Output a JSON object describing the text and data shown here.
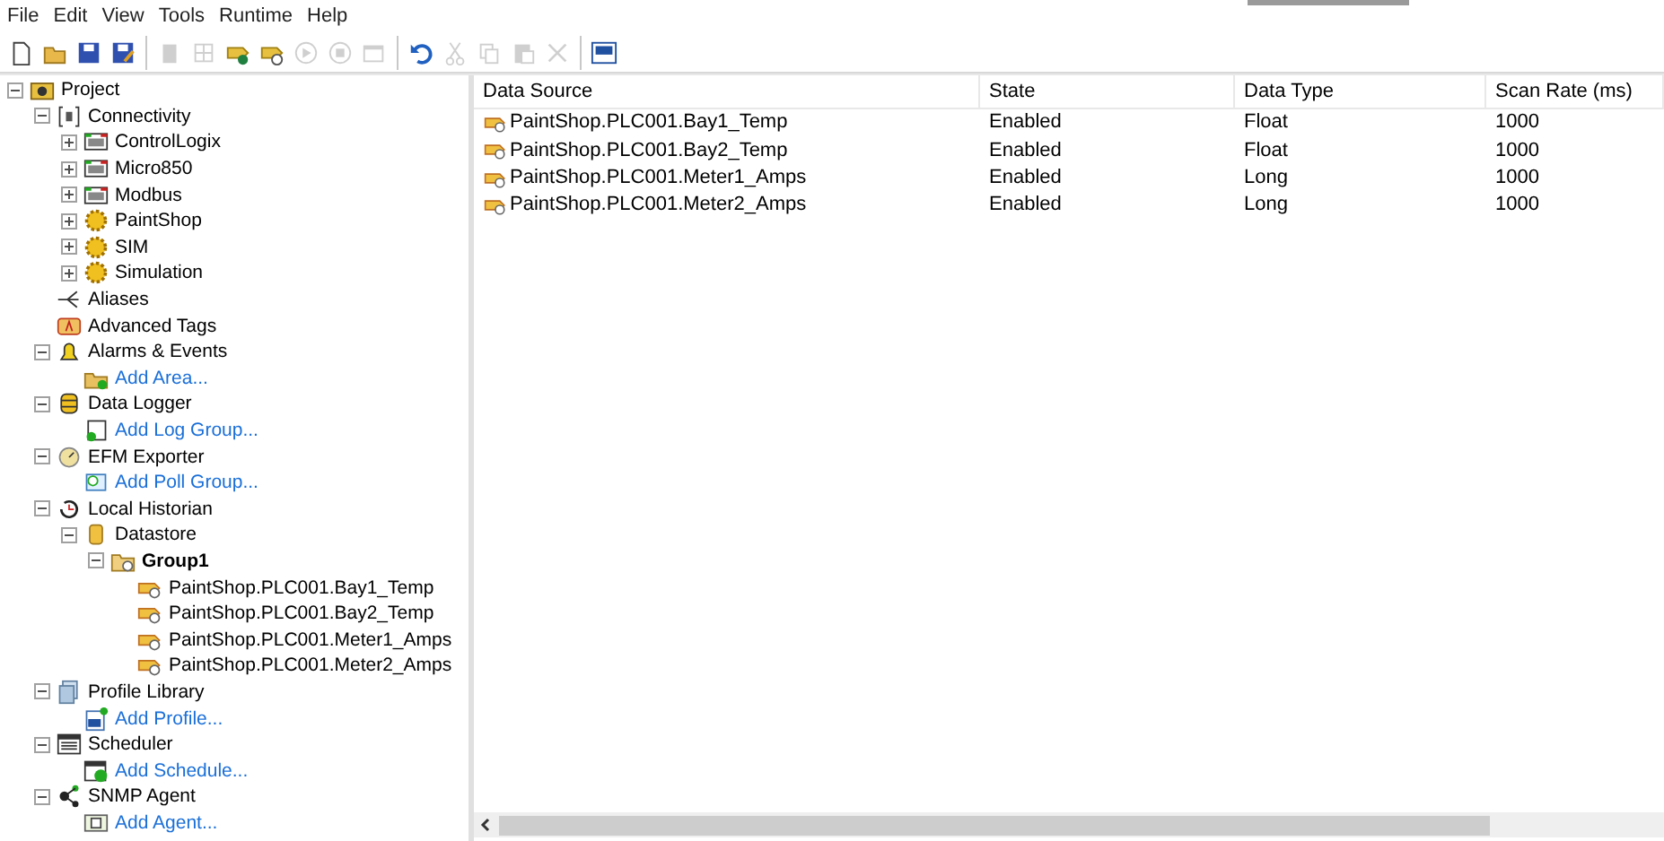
{
  "menu": [
    "File",
    "Edit",
    "View",
    "Tools",
    "Runtime",
    "Help"
  ],
  "toolbar": [
    [
      {
        "kind": "new",
        "disabled": false
      },
      {
        "kind": "open",
        "disabled": false
      },
      {
        "kind": "save",
        "disabled": false
      },
      {
        "kind": "saveas",
        "disabled": false
      }
    ],
    [
      {
        "kind": "trash",
        "disabled": true
      },
      {
        "kind": "grid",
        "disabled": true
      },
      {
        "kind": "tagadd",
        "disabled": false
      },
      {
        "kind": "tagclock",
        "disabled": false
      },
      {
        "kind": "play",
        "disabled": true
      },
      {
        "kind": "stop",
        "disabled": true
      },
      {
        "kind": "window",
        "disabled": true
      }
    ],
    [
      {
        "kind": "undo",
        "disabled": false
      },
      {
        "kind": "cut",
        "disabled": true
      },
      {
        "kind": "copy",
        "disabled": true
      },
      {
        "kind": "paste",
        "disabled": true
      },
      {
        "kind": "cross",
        "disabled": true
      }
    ],
    [
      {
        "kind": "qc",
        "disabled": false
      }
    ]
  ],
  "tree": [
    {
      "label": "Project",
      "kind": "project",
      "expanded": true,
      "children": [
        {
          "label": "Connectivity",
          "kind": "connectivity",
          "expanded": true,
          "children": [
            {
              "label": "ControlLogix",
              "kind": "device",
              "expanded": false
            },
            {
              "label": "Micro850",
              "kind": "device",
              "expanded": false
            },
            {
              "label": "Modbus",
              "kind": "device",
              "expanded": false
            },
            {
              "label": "PaintShop",
              "kind": "gear",
              "expanded": false
            },
            {
              "label": "SIM",
              "kind": "gear",
              "expanded": false
            },
            {
              "label": "Simulation",
              "kind": "gear",
              "expanded": false
            }
          ]
        },
        {
          "label": "Aliases",
          "kind": "alias"
        },
        {
          "label": "Advanced Tags",
          "kind": "advtags"
        },
        {
          "label": "Alarms & Events",
          "kind": "bell",
          "expanded": true,
          "children": [
            {
              "label": "Add Area...",
              "kind": "addfolder"
            }
          ]
        },
        {
          "label": "Data Logger",
          "kind": "logger",
          "expanded": true,
          "children": [
            {
              "label": "Add Log Group...",
              "kind": "addgroup"
            }
          ]
        },
        {
          "label": "EFM Exporter",
          "kind": "efm",
          "expanded": true,
          "children": [
            {
              "label": "Add Poll Group...",
              "kind": "addpoll"
            }
          ]
        },
        {
          "label": "Local Historian",
          "kind": "history",
          "expanded": true,
          "children": [
            {
              "label": "Datastore",
              "kind": "datastore",
              "expanded": true,
              "children": [
                {
                  "label": "Group1",
                  "kind": "group",
                  "selected": true,
                  "expanded": true,
                  "children": [
                    {
                      "label": "PaintShop.PLC001.Bay1_Temp",
                      "kind": "tag"
                    },
                    {
                      "label": "PaintShop.PLC001.Bay2_Temp",
                      "kind": "tag"
                    },
                    {
                      "label": "PaintShop.PLC001.Meter1_Amps",
                      "kind": "tag"
                    },
                    {
                      "label": "PaintShop.PLC001.Meter2_Amps",
                      "kind": "tag"
                    }
                  ]
                }
              ]
            }
          ]
        },
        {
          "label": "Profile Library",
          "kind": "profile",
          "expanded": true,
          "children": [
            {
              "label": "Add Profile...",
              "kind": "addprofile"
            }
          ]
        },
        {
          "label": "Scheduler",
          "kind": "calendar",
          "expanded": true,
          "children": [
            {
              "label": "Add Schedule...",
              "kind": "addschedule"
            }
          ]
        },
        {
          "label": "SNMP Agent",
          "kind": "snmp",
          "expanded": true,
          "children": [
            {
              "label": "Add Agent...",
              "kind": "addagent"
            }
          ]
        }
      ]
    }
  ],
  "table": {
    "columns": [
      "Data Source",
      "State",
      "Data Type",
      "Scan Rate (ms)"
    ],
    "rows": [
      [
        "PaintShop.PLC001.Bay1_Temp",
        "Enabled",
        "Float",
        "1000"
      ],
      [
        "PaintShop.PLC001.Bay2_Temp",
        "Enabled",
        "Float",
        "1000"
      ],
      [
        "PaintShop.PLC001.Meter1_Amps",
        "Enabled",
        "Long",
        "1000"
      ],
      [
        "PaintShop.PLC001.Meter2_Amps",
        "Enabled",
        "Long",
        "1000"
      ]
    ]
  }
}
